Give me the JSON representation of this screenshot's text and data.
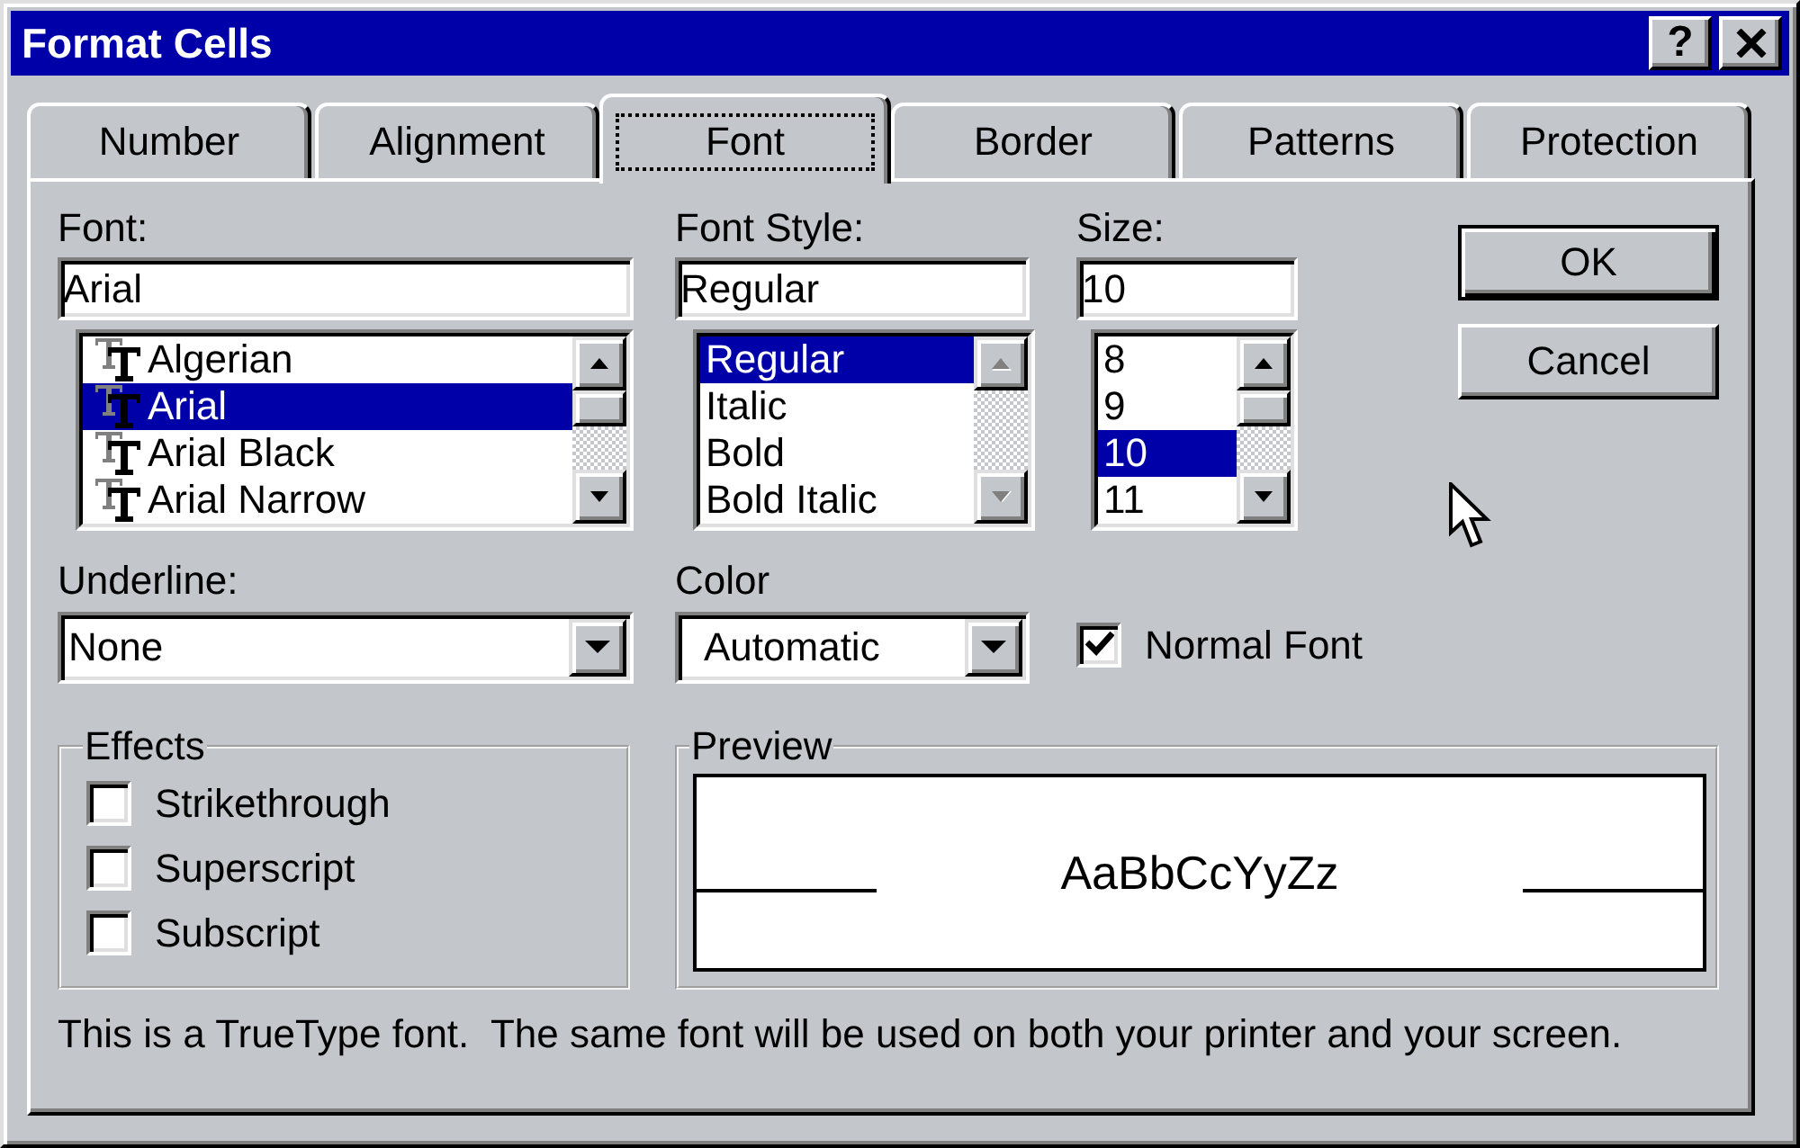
{
  "window": {
    "title": "Format Cells",
    "title_buttons": [
      {
        "kind": "help",
        "label": "?"
      },
      {
        "kind": "close"
      }
    ]
  },
  "tabs": [
    {
      "label": "Number",
      "selected": false,
      "focused": false
    },
    {
      "label": "Alignment",
      "selected": false,
      "focused": false
    },
    {
      "label": "Font",
      "selected": true,
      "focused": true
    },
    {
      "label": "Border",
      "selected": false,
      "focused": false
    },
    {
      "label": "Patterns",
      "selected": false,
      "focused": false
    },
    {
      "label": "Protection",
      "selected": false,
      "focused": false
    }
  ],
  "font": {
    "label": "Font:",
    "value": "Arial",
    "scrollbar_disabled": false,
    "items": [
      {
        "label": "Algerian",
        "kind": "truetype",
        "selected": false
      },
      {
        "label": "Arial",
        "kind": "truetype",
        "selected": true
      },
      {
        "label": "Arial Black",
        "kind": "truetype",
        "selected": false
      },
      {
        "label": "Arial Narrow",
        "kind": "truetype",
        "selected": false
      }
    ]
  },
  "font_style": {
    "label": "Font Style:",
    "value": "Regular",
    "scrollbar_disabled": true,
    "items": [
      {
        "label": "Regular",
        "selected": true
      },
      {
        "label": "Italic",
        "selected": false
      },
      {
        "label": "Bold",
        "selected": false
      },
      {
        "label": "Bold Italic",
        "selected": false
      }
    ]
  },
  "size": {
    "label": "Size:",
    "value": "10",
    "scrollbar_disabled": false,
    "items": [
      {
        "label": "8",
        "selected": false
      },
      {
        "label": "9",
        "selected": false
      },
      {
        "label": "10",
        "selected": true
      },
      {
        "label": "11",
        "selected": false
      }
    ]
  },
  "buttons": [
    {
      "label": "OK",
      "default": true
    },
    {
      "label": "Cancel",
      "default": false
    }
  ],
  "underline": {
    "label": "Underline:",
    "value": "None"
  },
  "color": {
    "label": "Color",
    "value": "Automatic"
  },
  "normal_font": {
    "label": "Normal Font",
    "checked": true
  },
  "effects": {
    "title": "Effects",
    "options": [
      {
        "label": "Strikethrough",
        "checked": false
      },
      {
        "label": "Superscript",
        "checked": false
      },
      {
        "label": "Subscript",
        "checked": false
      }
    ]
  },
  "preview": {
    "title": "Preview",
    "sample": "AaBbCcYyZz"
  },
  "note": "This is a TrueType font.  The same font will be used on both your printer and your screen."
}
